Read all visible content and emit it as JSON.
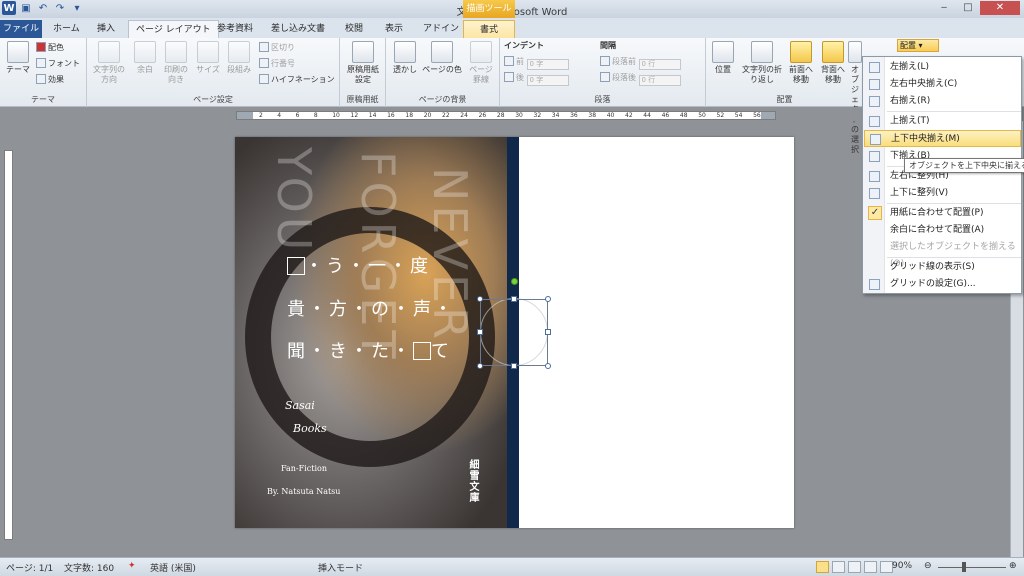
{
  "window": {
    "title": "文書1 - Microsoft Word",
    "context_header": "描画ツール",
    "controls": [
      "‒",
      "□",
      "✕"
    ]
  },
  "tabs": [
    {
      "label": "ファイル",
      "state": "file"
    },
    {
      "label": "ホーム",
      "state": "normal"
    },
    {
      "label": "挿入",
      "state": "normal"
    },
    {
      "label": "ページ レイアウト",
      "state": "active"
    },
    {
      "label": "参考資料",
      "state": "normal"
    },
    {
      "label": "差し込み文書",
      "state": "normal"
    },
    {
      "label": "校閲",
      "state": "normal"
    },
    {
      "label": "表示",
      "state": "normal"
    },
    {
      "label": "アドイン",
      "state": "normal"
    },
    {
      "label": "書式",
      "state": "context"
    }
  ],
  "ribbon": {
    "theme": {
      "group_label": "テーマ",
      "theme_btn": "テーマ",
      "colors": "配色",
      "fonts": "フォント",
      "effects": "効果"
    },
    "page_setup": {
      "group_label": "ページ設定",
      "text_direction": "文字列の方向",
      "margins": "余白",
      "orientation": "印刷の向き",
      "size": "サイズ",
      "columns": "段組み",
      "breaks": "区切り",
      "line_numbers": "行番号",
      "hyphenation": "ハイフネーション"
    },
    "manuscript": {
      "group_label": "原稿用紙",
      "btn": "原稿用紙設定"
    },
    "page_background": {
      "group_label": "ページの背景",
      "watermark": "透かし",
      "page_color": "ページの色",
      "page_borders": "ページ罫線"
    },
    "paragraph": {
      "group_label": "段落",
      "indent_label": "インデント",
      "indent_left": "前",
      "indent_right": "後",
      "spacing_label": "間隔",
      "spacing_before": "段落前",
      "spacing_after": "段落後",
      "indent_left_val": "0 字",
      "indent_right_val": "0 字",
      "spacing_before_val": "0 行",
      "spacing_after_val": "0 行"
    },
    "arrange": {
      "group_label": "配置",
      "position": "位置",
      "wrap_text": "文字列の折り返し",
      "bring_forward": "前面へ移動",
      "send_backward": "背面へ移動",
      "selection_pane": "オブジェクトの選択",
      "align": "配置"
    }
  },
  "ruler": {
    "numbers": [
      "2",
      "4",
      "6",
      "8",
      "10",
      "12",
      "14",
      "16",
      "18",
      "20",
      "22",
      "24",
      "26",
      "28",
      "30",
      "32",
      "34",
      "36",
      "38",
      "40",
      "42",
      "44",
      "46",
      "48",
      "50",
      "52",
      "54",
      "56"
    ]
  },
  "cover": {
    "big_letters": [
      "NEVER",
      "FORGET",
      "YOU"
    ],
    "poem_lines": [
      "う・一・度",
      "貴・方・の・声・",
      "聞・き・た・",
      "て"
    ],
    "script1": "Sasai",
    "script2": "Books",
    "fanfiction": "Fan-Fiction",
    "author": "By. Natsuta Natsu",
    "publisher": "細雪文庫"
  },
  "page_mark": "↵",
  "align_menu": {
    "items": [
      {
        "label": "左揃え(L)",
        "state": "normal"
      },
      {
        "label": "左右中央揃え(C)",
        "state": "normal"
      },
      {
        "label": "右揃え(R)",
        "state": "normal"
      },
      {
        "label": "上揃え(T)",
        "state": "normal"
      },
      {
        "label": "上下中央揃え(M)",
        "state": "hover"
      },
      {
        "label": "下揃え(B)",
        "state": "normal"
      },
      {
        "label": "左右に整列(H)",
        "state": "normal"
      },
      {
        "label": "上下に整列(V)",
        "state": "normal"
      },
      {
        "label": "用紙に合わせて配置(P)",
        "state": "checked"
      },
      {
        "label": "余白に合わせて配置(A)",
        "state": "normal"
      },
      {
        "label": "選択したオブジェクトを揃える(O)",
        "state": "disabled"
      },
      {
        "label": "グリッド線の表示(S)",
        "state": "normal"
      },
      {
        "label": "グリッドの設定(G)...",
        "state": "normal"
      }
    ],
    "tooltip": "オブジェクトを上下中央に揃える"
  },
  "statusbar": {
    "page": "ページ: 1/1",
    "words": "文字数: 160",
    "language": "英語 (米国)",
    "mode": "挿入モード",
    "zoom": "90%"
  }
}
